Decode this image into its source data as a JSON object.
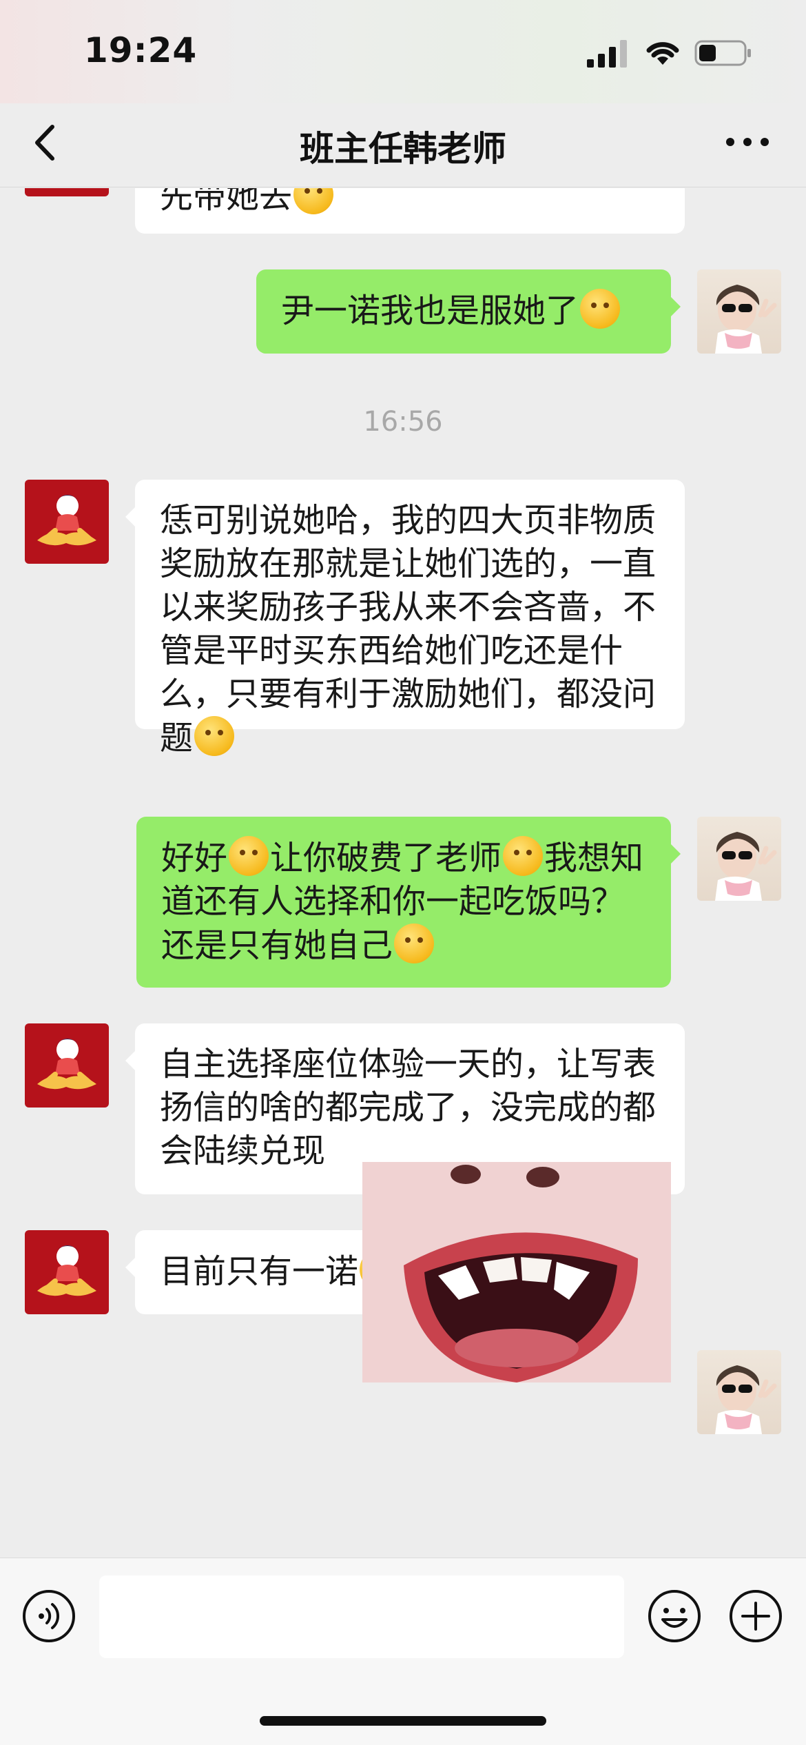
{
  "status_bar": {
    "time": "19:24"
  },
  "header": {
    "title": "班主任韩老师"
  },
  "messages": [
    {
      "side": "left",
      "text": "先带她去",
      "partial": true
    },
    {
      "side": "right",
      "text": "尹一诺我也是服她了"
    },
    {
      "type": "timestamp",
      "text": "16:56"
    },
    {
      "side": "left",
      "text": "恁可别说她哈，我的四大页非物质奖励放在那就是让她们选的，一直以来奖励孩子我从来不会吝啬，不管是平时买东西给她们吃还是什么，只要有利于激励她们，都没问题"
    },
    {
      "side": "right",
      "text_parts": [
        "好好",
        "让你破费了老师",
        "我想知道还有人选择和你一起吃饭吗？还是只有她自己"
      ]
    },
    {
      "side": "left",
      "text": "自主选择座位体验一天的，让写表扬信的啥的都完成了，没完成的都会陆续兑现"
    },
    {
      "side": "left",
      "text": "目前只有一诺"
    },
    {
      "side": "right",
      "type": "image",
      "description": "photo"
    }
  ],
  "input_bar": {
    "placeholder": ""
  },
  "icons": {
    "back": "chevron-left-icon",
    "more": "more-dots-icon",
    "voice": "voice-icon",
    "emoji": "emoji-face-icon",
    "plus": "plus-icon"
  },
  "colors": {
    "my_bubble": "#95ec69",
    "their_bubble": "#ffffff",
    "background": "#ededed",
    "teacher_avatar": "#b5121b"
  }
}
